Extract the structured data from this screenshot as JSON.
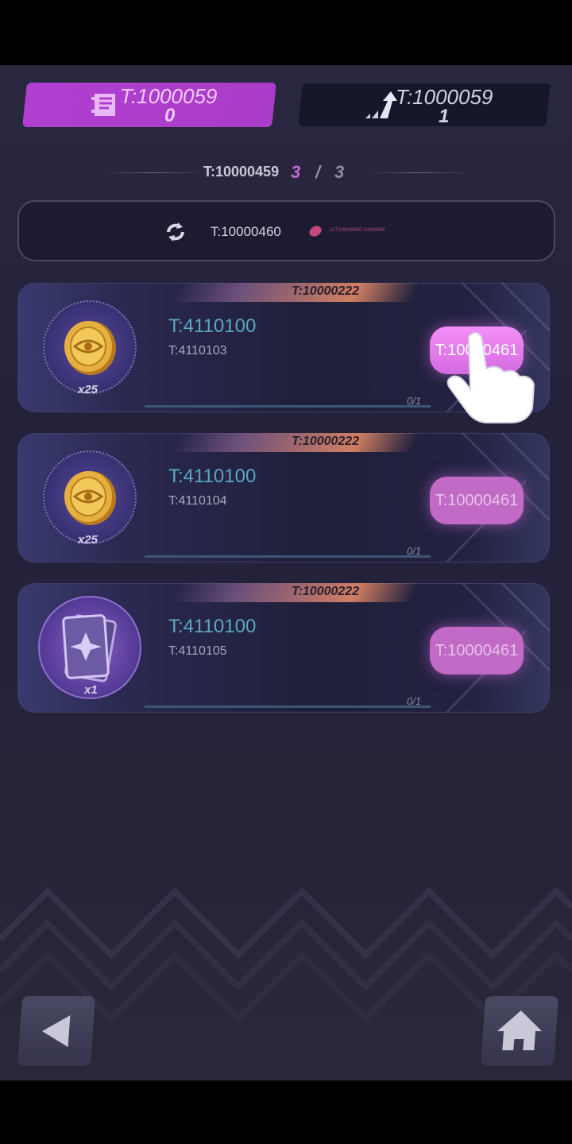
{
  "tabs": [
    {
      "title": "T:1000059",
      "count": "0",
      "active": true,
      "icon": "scroll-icon"
    },
    {
      "title": "T:1000059",
      "count": "1",
      "active": false,
      "icon": "growth-arrow-icon"
    }
  ],
  "progress": {
    "label": "T:10000459",
    "current": "3",
    "separator": "/",
    "total": "3"
  },
  "refresh": {
    "label": "T:10000460",
    "small_text": "11T:10000458T:10000458"
  },
  "tasks": [
    {
      "tag": "T:10000222",
      "title": "T:4110100",
      "subtitle": "T:4110103",
      "qty": "x25",
      "progress": "0/1",
      "button": "T:10000461",
      "reward": "gold-coin-icon"
    },
    {
      "tag": "T:10000222",
      "title": "T:4110100",
      "subtitle": "T:4110104",
      "qty": "x25",
      "progress": "0/1",
      "button": "T:10000461",
      "reward": "gold-coin-icon"
    },
    {
      "tag": "T:10000222",
      "title": "T:4110100",
      "subtitle": "T:4110105",
      "qty": "x1",
      "progress": "0/1",
      "button": "T:10000461",
      "reward": "card-pack-icon"
    }
  ],
  "colors": {
    "accent": "#b13fd0",
    "title": "#5aa7c0",
    "button": "#c26bc6"
  }
}
